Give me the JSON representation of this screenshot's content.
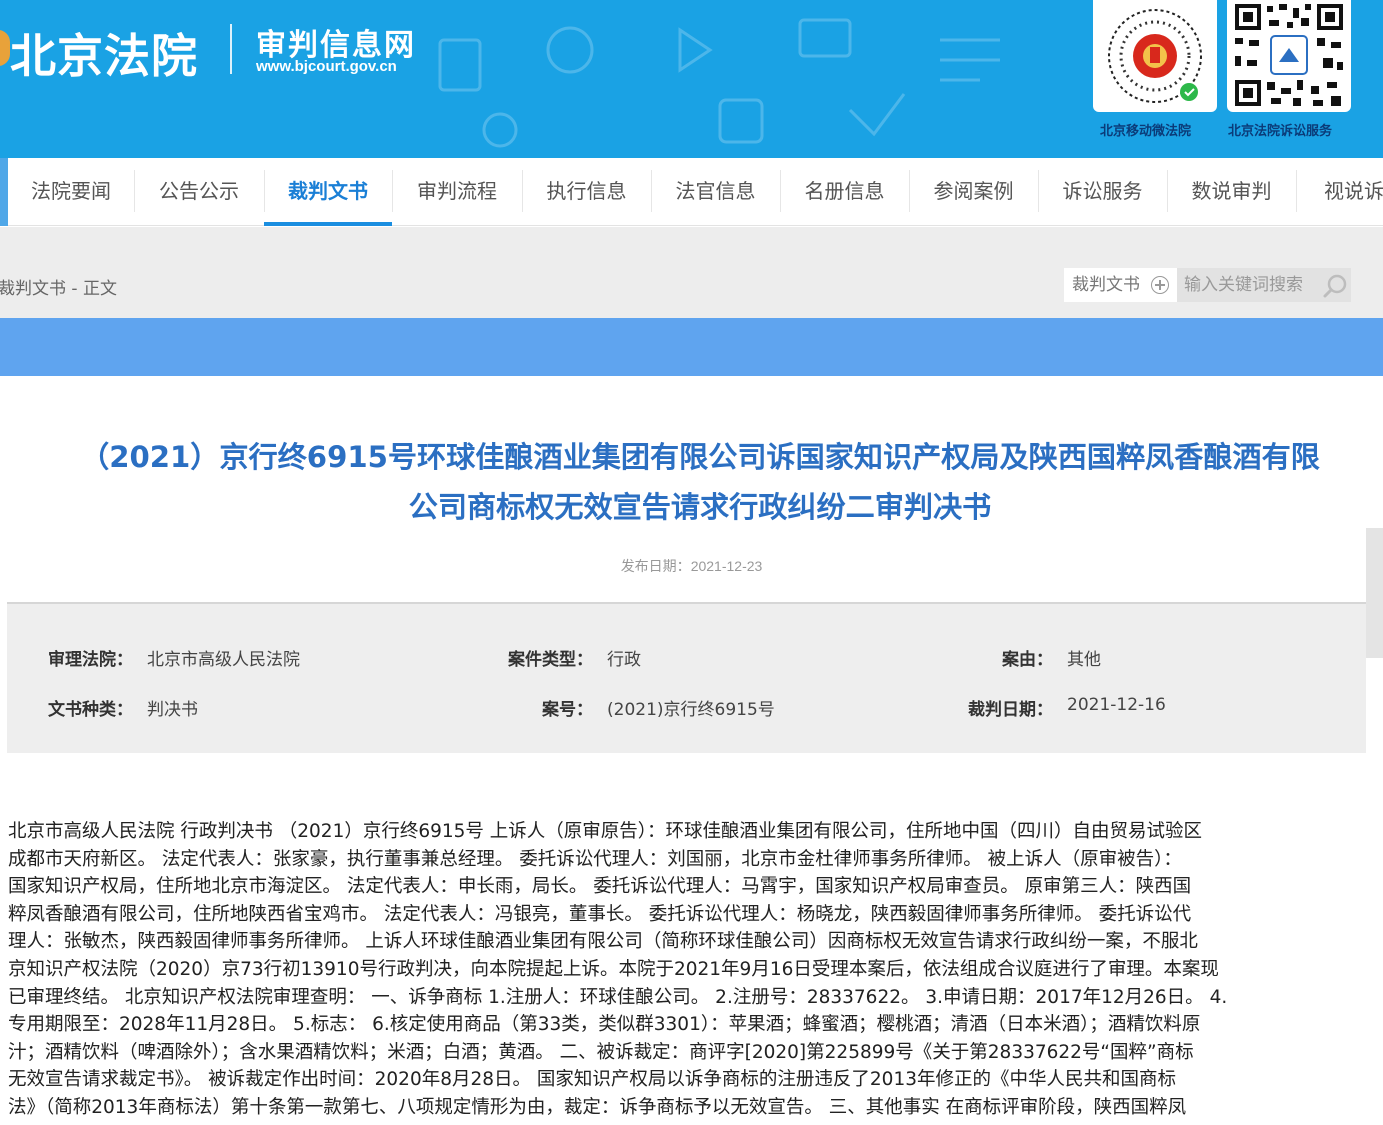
{
  "header": {
    "court_name": "北京法院",
    "site_name": "审判信息网",
    "site_url": "www.bjcourt.gov.cn",
    "qr_labels": [
      "北京移动微法院",
      "北京法院诉讼服务"
    ]
  },
  "nav": {
    "items": [
      "法院要闻",
      "公告公示",
      "裁判文书",
      "审判流程",
      "执行信息",
      "法官信息",
      "名册信息",
      "参阅案例",
      "诉讼服务",
      "数说审判",
      "视说诉"
    ],
    "active": "裁判文书"
  },
  "breadcrumb": "裁判文书 - 正文",
  "search": {
    "category": "裁判文书",
    "placeholder": "输入关键词搜索"
  },
  "document": {
    "title_line1": "（2021）京行终6915号环球佳酿酒业集团有限公司诉国家知识产权局及陕西国粹凤香酿酒有限",
    "title_line2": "公司商标权无效宣告请求行政纠纷二审判决书",
    "publish_label": "发布日期：",
    "publish_date": "2021-12-23"
  },
  "info": {
    "court_label": "审理法院：",
    "court": "北京市高级人民法院",
    "case_type_label": "案件类型：",
    "case_type": "行政",
    "cause_label": "案由：",
    "cause": "其他",
    "doc_type_label": "文书种类：",
    "doc_type": "判决书",
    "case_no_label": "案号：",
    "case_no": "(2021)京行终6915号",
    "judge_date_label": "裁判日期：",
    "judge_date": "2021-12-16"
  },
  "body_lines": [
    "北京市高级人民法院 行政判决书 （2021）京行终6915号 上诉人（原审原告）：环球佳酿酒业集团有限公司，住所地中国（四川）自由贸易试验区",
    "成都市天府新区。 法定代表人：张家豪，执行董事兼总经理。 委托诉讼代理人：刘国丽，北京市金杜律师事务所律师。 被上诉人（原审被告）：",
    "国家知识产权局，住所地北京市海淀区。 法定代表人：申长雨，局长。 委托诉讼代理人：马霄宇，国家知识产权局审查员。 原审第三人：陕西国",
    "粹凤香酿酒有限公司，住所地陕西省宝鸡市。 法定代表人：冯银亮，董事长。 委托诉讼代理人：杨晓龙，陕西毅固律师事务所律师。 委托诉讼代",
    "理人：张敏杰，陕西毅固律师事务所律师。 上诉人环球佳酿酒业集团有限公司（简称环球佳酿公司）因商标权无效宣告请求行政纠纷一案，不服北",
    "京知识产权法院（2020）京73行初13910号行政判决，向本院提起上诉。本院于2021年9月16日受理本案后，依法组成合议庭进行了审理。本案现",
    "已审理终结。 北京知识产权法院审理查明： 一、诉争商标 1.注册人：环球佳酿公司。 2.注册号：28337622。 3.申请日期：2017年12月26日。 4.",
    "专用期限至：2028年11月28日。 5.标志： 6.核定使用商品（第33类，类似群3301）：苹果酒；蜂蜜酒；樱桃酒；清酒（日本米酒）；酒精饮料原",
    "汁；酒精饮料（啤酒除外）；含水果酒精饮料；米酒；白酒；黄酒。 二、被诉裁定：商评字[2020]第225899号《关于第28337622号“国粹”商标",
    "无效宣告请求裁定书》。 被诉裁定作出时间：2020年8月28日。 国家知识产权局以诉争商标的注册违反了2013年修正的《中华人民共和国商标",
    "法》（简称2013年商标法）第十条第一款第七、八项规定情形为由，裁定：诉争商标予以无效宣告。 三、其他事实 在商标评审阶段，陕西国粹凤"
  ]
}
